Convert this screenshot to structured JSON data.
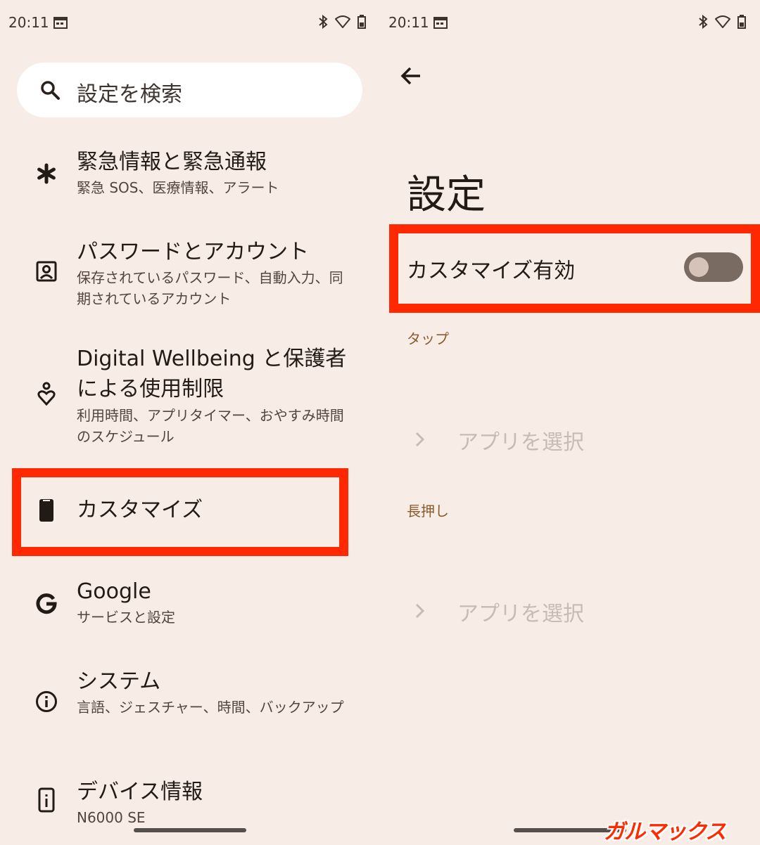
{
  "left": {
    "status": {
      "time": "20:11"
    },
    "search": {
      "placeholder": "設定を検索"
    },
    "items": [
      {
        "icon": "asterisk-icon",
        "title": "緊急情報と緊急通報",
        "subtitle": "緊急 SOS、医療情報、アラート"
      },
      {
        "icon": "account-box-icon",
        "title": "パスワードとアカウント",
        "subtitle": "保存されているパスワード、自動入力、同期されているアカウント"
      },
      {
        "icon": "wellbeing-icon",
        "title": "Digital Wellbeing と保護者による使用制限",
        "subtitle": "利用時間、アプリタイマー、おやすみ時間のスケジュール"
      },
      {
        "icon": "phone-icon",
        "title": "カスタマイズ",
        "subtitle": ""
      },
      {
        "icon": "google-icon",
        "title": "Google",
        "subtitle": "サービスと設定"
      },
      {
        "icon": "info-icon",
        "title": "システム",
        "subtitle": "言語、ジェスチャー、時間、バックアップ"
      },
      {
        "icon": "device-info-icon",
        "title": "デバイス情報",
        "subtitle": "N6000 SE"
      }
    ]
  },
  "right": {
    "status": {
      "time": "20:11"
    },
    "title": "設定",
    "toggle": {
      "label": "カスタマイズ有効",
      "checked": false
    },
    "sections": [
      {
        "header": "タップ",
        "action": "アプリを選択"
      },
      {
        "header": "長押し",
        "action": "アプリを選択"
      }
    ]
  },
  "watermark": "ガルマックス",
  "colors": {
    "background": "#f8ede6",
    "highlight": "#ff2800",
    "section_header": "#8a5b2e",
    "disabled_text": "#c8bbb3"
  }
}
